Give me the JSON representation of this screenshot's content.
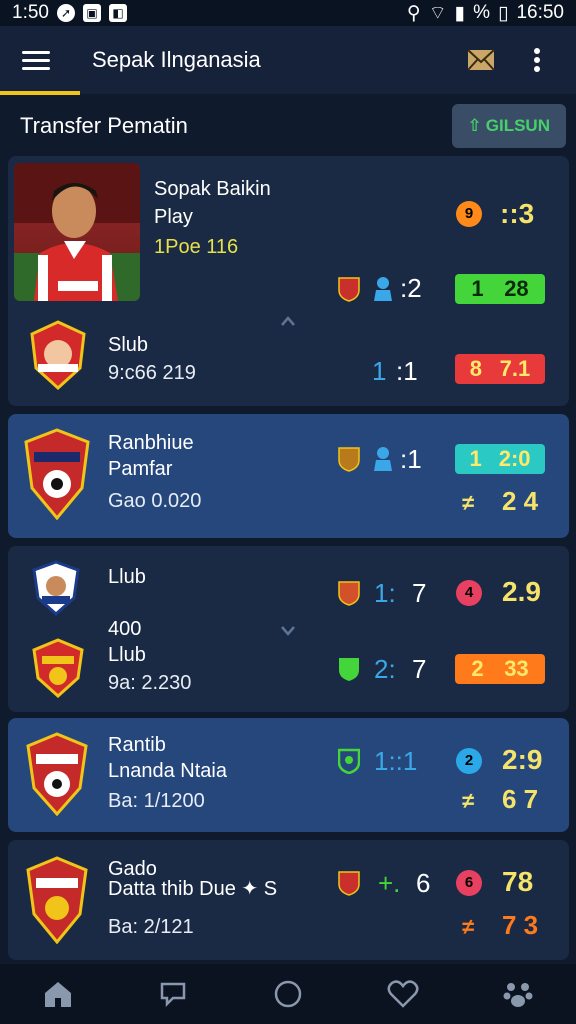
{
  "status": {
    "time_left": "1:50",
    "battery": "%",
    "time_right": "16:50"
  },
  "appbar": {
    "title": "Sepak Ilnganasia"
  },
  "section": {
    "title": "Transfer Pematin",
    "button_label": "GILSUN"
  },
  "featured": {
    "player_name_1": "Sopak Baikin",
    "player_name_2": "Play",
    "player_info": "1Poe 116",
    "top_badge": "9",
    "top_value": "::3",
    "mini_score": ":2",
    "pill": {
      "left": "1",
      "right": "28",
      "color": "#44d53a"
    },
    "club": {
      "name": "Slub",
      "sub": "9:c66 219",
      "score_a": "1",
      "score_b": ":1",
      "pill": {
        "left": "8",
        "right": "7.1",
        "color": "#e83a3a"
      }
    }
  },
  "cards": [
    {
      "name_1": "Ranbhiue",
      "name_2": "Pamfar",
      "sub": "Gao 0.020",
      "score": ":1",
      "pill": {
        "left": "1",
        "right": "2:0",
        "color": "#2ac9c4"
      },
      "bottom_sym": "≠",
      "bottom_value": "2 4"
    },
    {
      "name_top": "Llub",
      "name_mid": "400",
      "name_2": "Llub",
      "sub": "9a: 2.230",
      "score_top_a": "1:",
      "score_top_b": "7",
      "badge_top": "4",
      "badge_top_color": "#e84060",
      "value_top": "2.9",
      "score_bot_a": "2:",
      "score_bot_b": "7",
      "pill": {
        "left": "2",
        "right": "33",
        "color": "#ff7a1a"
      }
    },
    {
      "name_1": "Rantib",
      "name_2": "Lnanda Ntaia",
      "sub": "Ba: 1/1200",
      "score": "1::1",
      "badge": "2",
      "badge_color": "#2aa8e8",
      "value_top": "2:9",
      "bottom_sym": "≠",
      "bottom_value": "6 7"
    },
    {
      "name_1": "Gado",
      "name_2": "Datta thib Due ✦ S",
      "sub": "Ba: 2/121",
      "score_sym": "+.",
      "score": "6",
      "badge": "6",
      "badge_color": "#e84060",
      "value_top": "78",
      "bottom_sym": "≠",
      "bottom_value": "7 3"
    }
  ],
  "icons": [
    "menu-icon",
    "mail-icon",
    "more-icon",
    "home-icon",
    "chat-icon",
    "circle-icon",
    "heart-icon",
    "paw-icon"
  ],
  "colors": {
    "accent": "#f0c419",
    "card": "#1a2a44",
    "card_highlight": "#25477c",
    "background": "#0f1a2c"
  }
}
